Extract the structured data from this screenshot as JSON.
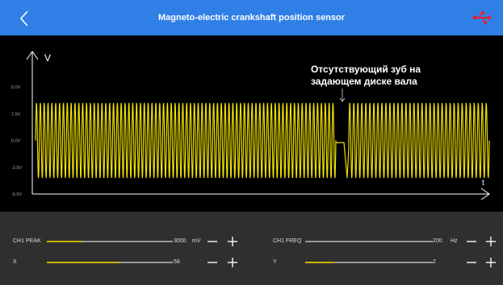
{
  "header": {
    "title": "Magneto-electric crankshaft position sensor",
    "back_icon": "chevron-left-icon",
    "usb_icon": "usb-icon",
    "usb_color": "#e0242a",
    "bar_color": "#2f7fe6"
  },
  "chart_data": {
    "type": "line",
    "title": "",
    "ylabel": "V",
    "xlabel": "t",
    "yticks": [
      "5.0V",
      "2.5V",
      "0.0V",
      "-2.5V",
      "-5.0V"
    ],
    "ylim": [
      -5,
      5
    ],
    "series": [
      {
        "color": "#f0e100",
        "waveform": "sine",
        "amplitude_v": 3.5,
        "cycles_before_gap": 78,
        "cycles_after_gap": 35,
        "gap_level_v": -0.2
      }
    ],
    "annotation": "Отсутствующий зуб на задающем диске вала"
  },
  "controls": {
    "ch1_peak": {
      "label": "CH1 PEAK",
      "value": "3000",
      "unit": "mV",
      "level": 0.28
    },
    "ch1_freq": {
      "label": "CH1 FREQ",
      "value": "200",
      "unit": "Hz",
      "level": 0.0
    },
    "x": {
      "label": "X",
      "value": "58",
      "level": 0.58
    },
    "y": {
      "label": "Y",
      "value": "2",
      "level": 0.22
    },
    "minus_icon": "minus-icon",
    "plus_icon": "plus-icon"
  }
}
